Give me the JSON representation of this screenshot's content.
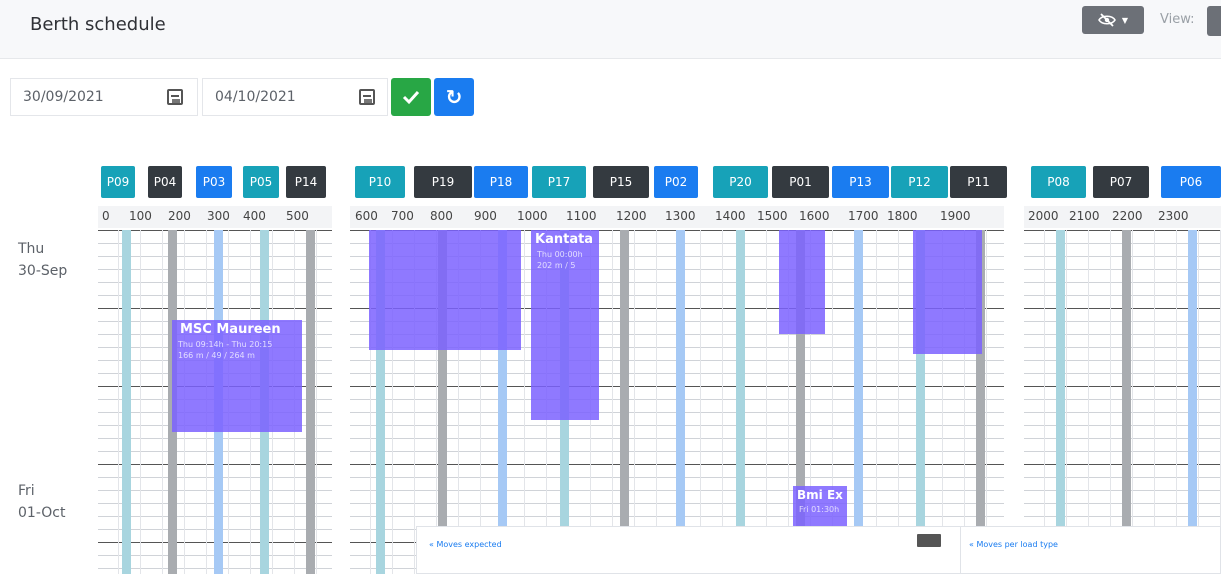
{
  "header": {
    "title": "Berth schedule",
    "view_label": "View:"
  },
  "filters": {
    "start_date": "30/09/2021",
    "end_date": "04/10/2021"
  },
  "colors": {
    "teal": "#17a2b8",
    "dark": "#343a40",
    "blue": "#1a7cf0",
    "vessel": "#7b61ff",
    "ok": "#28a745"
  },
  "berth_groups": [
    [
      {
        "label": "P09",
        "color": "teal"
      },
      {
        "label": "P04",
        "color": "dark"
      },
      {
        "label": "P03",
        "color": "blue"
      },
      {
        "label": "P05",
        "color": "teal"
      },
      {
        "label": "P14",
        "color": "dark"
      }
    ],
    [
      {
        "label": "P10",
        "color": "teal"
      },
      {
        "label": "P19",
        "color": "dark"
      },
      {
        "label": "P18",
        "color": "blue"
      },
      {
        "label": "P17",
        "color": "teal"
      },
      {
        "label": "P15",
        "color": "dark"
      },
      {
        "label": "P02",
        "color": "blue"
      },
      {
        "label": "P20",
        "color": "teal"
      },
      {
        "label": "P01",
        "color": "dark"
      },
      {
        "label": "P13",
        "color": "blue"
      },
      {
        "label": "P12",
        "color": "teal"
      },
      {
        "label": "P11",
        "color": "dark"
      }
    ],
    [
      {
        "label": "P08",
        "color": "teal"
      },
      {
        "label": "P07",
        "color": "dark"
      },
      {
        "label": "P06",
        "color": "blue"
      }
    ]
  ],
  "ticks": [
    "0",
    "100",
    "200",
    "300",
    "400",
    "500",
    "600",
    "700",
    "800",
    "900",
    "1000",
    "1100",
    "1200",
    "1300",
    "1400",
    "1500",
    "1600",
    "1700",
    "1800",
    "1900",
    "2000",
    "2100",
    "2200",
    "2300"
  ],
  "days": [
    {
      "weekday": "Thu",
      "date": "30-Sep"
    },
    {
      "weekday": "Fri",
      "date": "01-Oct"
    }
  ],
  "vessels": [
    {
      "name": "MSC Maureen",
      "line1": "Thu 09:14h - Thu 20:15",
      "line2": "166 m / 49 / 264 m"
    },
    {
      "name": "Kantata",
      "line1": "Thu 00:00h",
      "line2": "202 m / 5"
    },
    {
      "name": "Bmi Ex",
      "line1": "Fri 01:30h",
      "line2": ""
    },
    {
      "name": "",
      "line1": "",
      "line2": ""
    },
    {
      "name": "",
      "line1": "",
      "line2": ""
    },
    {
      "name": "",
      "line1": "",
      "line2": ""
    }
  ],
  "panels": {
    "left_title": "« Moves expected",
    "right_title": "« Moves per load type"
  }
}
